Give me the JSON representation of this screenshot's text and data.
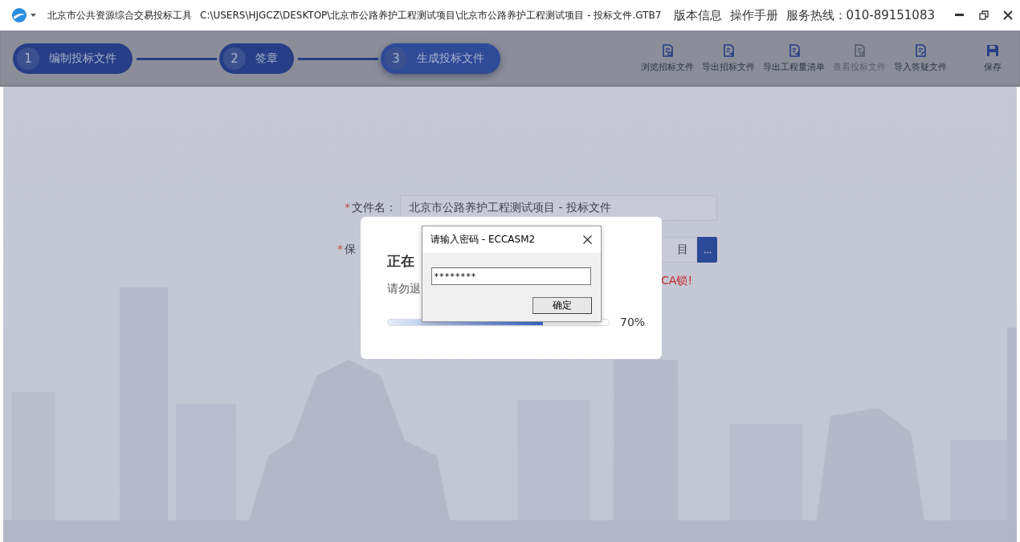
{
  "window": {
    "app_name": "北京市公共资源综合交易投标工具",
    "path": "C:\\USERS\\HJGCZ\\DESKTOP\\北京市公路养护工程测试项目\\北京市公路养护工程测试项目 - 投标文件.GTB7",
    "links": [
      "版本信息",
      "操作手册"
    ],
    "hotline": "服务热线：010-89151083"
  },
  "steps": [
    {
      "number": "1",
      "label": "编制投标文件",
      "selected": false
    },
    {
      "number": "2",
      "label": "签章",
      "selected": false
    },
    {
      "number": "3",
      "label": "生成投标文件",
      "selected": true
    }
  ],
  "toolbar": [
    {
      "label": "浏览招标文件",
      "kind": "view",
      "disabled": false
    },
    {
      "label": "导出招标文件",
      "kind": "export",
      "disabled": false
    },
    {
      "label": "导出工程量清单",
      "kind": "export",
      "disabled": false
    },
    {
      "label": "查看投标文件",
      "kind": "view",
      "disabled": true
    },
    {
      "label": "导入答疑文件",
      "kind": "import",
      "disabled": false
    },
    {
      "label": "保存",
      "kind": "save",
      "disabled": false
    }
  ],
  "form": {
    "required_mark": "*",
    "fields": [
      {
        "label": "文件名：",
        "required": true,
        "value": "北京市公路养护工程测试项目 - 投标文件"
      },
      {
        "label": "保",
        "required": true,
        "value": "目"
      }
    ],
    "warning": "CA锁!"
  },
  "progress_dialog": {
    "title": "正在",
    "message": "请勿退",
    "level": 0.7,
    "reading": "70%"
  },
  "password_dialog": {
    "title": "请输入密码 - ECCASM2",
    "value": "********",
    "button": "确定"
  }
}
